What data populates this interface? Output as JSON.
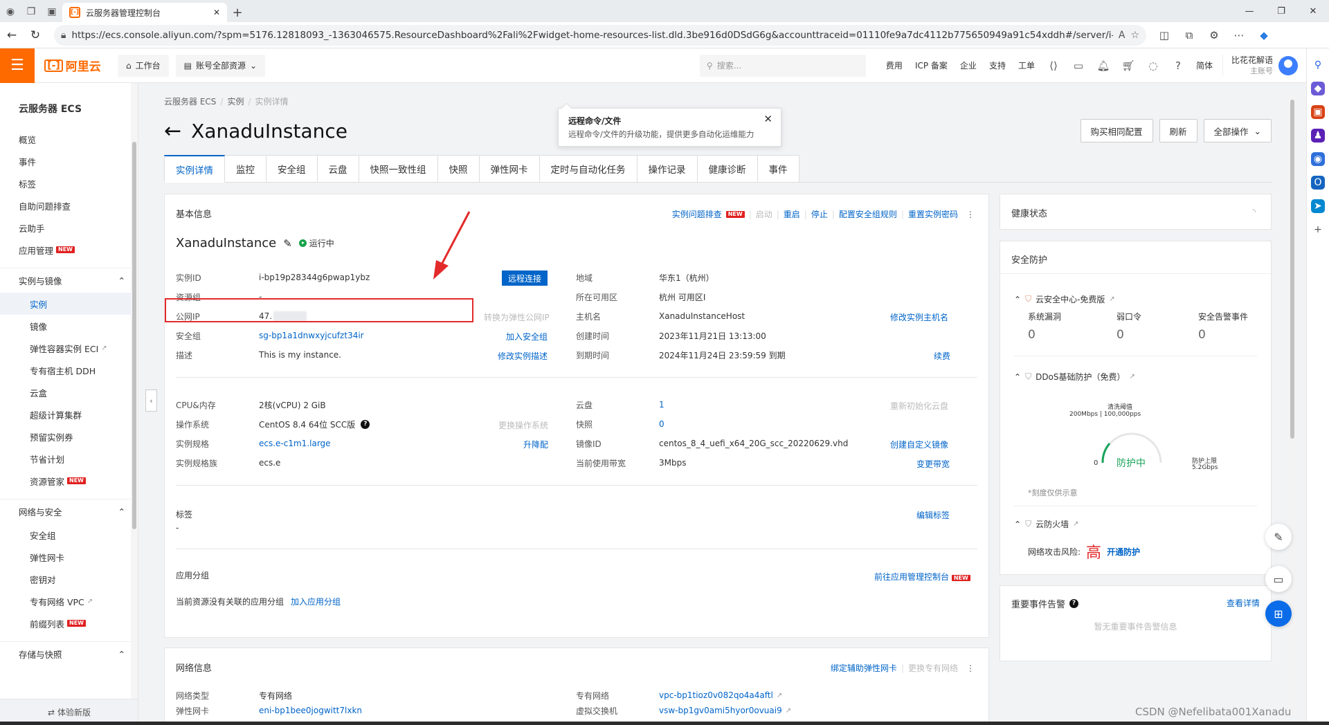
{
  "browser": {
    "tab_title": "云服务器管理控制台",
    "tab_favicon": "[-]",
    "url": "https://ecs.console.aliyun.com/?spm=5176.12818093_-1363046575.ResourceDashboard%2Fali%2Fwidget-home-resources-list.dld.3be916d0DSdG6g&accounttraceid=01110fe9a7dc4112b775650949a91c54xddh#/server/i-bp19p28344g6..."
  },
  "topnav": {
    "logo": "阿里云",
    "workbench": "工作台",
    "account_resources": "账号全部资源",
    "search_placeholder": "搜索...",
    "links": [
      "费用",
      "ICP 备案",
      "企业",
      "支持",
      "工单"
    ],
    "lang": "简体",
    "user_name": "比花花解语",
    "user_role": "主账号"
  },
  "sidebar": {
    "title": "云服务器 ECS",
    "top_items": [
      "概览",
      "事件",
      "标签",
      "自助问题排查",
      "云助手"
    ],
    "app_mgmt": "应用管理",
    "group1": "实例与镜像",
    "group1_items": [
      "实例",
      "镜像",
      "弹性容器实例 ECI",
      "专有宿主机 DDH",
      "云盒",
      "超级计算集群",
      "预留实例券",
      "节省计划",
      "资源管家"
    ],
    "group2": "网络与安全",
    "group2_items": [
      "安全组",
      "弹性网卡",
      "密钥对",
      "专有网络 VPC",
      "前缀列表"
    ],
    "group3": "存储与快照",
    "footer": "体验新版",
    "new_badge": "NEW"
  },
  "page": {
    "breadcrumb": [
      "云服务器 ECS",
      "实例",
      "实例详情"
    ],
    "title": "XanaduInstance",
    "tooltip_title": "远程命令/文件",
    "tooltip_text": "远程命令/文件的升级功能，提供更多自动化运维能力",
    "btn_buy": "购买相同配置",
    "btn_refresh": "刷新",
    "btn_all": "全部操作",
    "tabs": [
      "实例详情",
      "监控",
      "安全组",
      "云盘",
      "快照一致性组",
      "快照",
      "弹性网卡",
      "定时与自动化任务",
      "操作记录",
      "健康诊断",
      "事件"
    ]
  },
  "basic": {
    "header": "基本信息",
    "actions": {
      "troubleshoot": "实例问题排查",
      "start": "启动",
      "restart": "重启",
      "stop": "停止",
      "config_sg": "配置安全组规则",
      "reset_pwd": "重置实例密码"
    },
    "instance_name": "XanaduInstance",
    "status": "运行中",
    "remote_connect": "远程连接",
    "left": [
      {
        "label": "实例ID",
        "value": "i-bp19p28344g6pwap1ybz"
      },
      {
        "label": "资源组",
        "value": "-"
      },
      {
        "label": "公网IP",
        "value": "47."
      },
      {
        "label": "安全组",
        "value": "sg-bp1a1dnwxyjcufzt34ir"
      },
      {
        "label": "描述",
        "value": "This is my instance."
      }
    ],
    "left_links": {
      "eip": "转换为弹性公网IP",
      "add_sg": "加入安全组",
      "edit_desc": "修改实例描述"
    },
    "right": [
      {
        "label": "地域",
        "value": "华东1（杭州）"
      },
      {
        "label": "所在可用区",
        "value": "杭州 可用区I"
      },
      {
        "label": "主机名",
        "value": "XanaduInstanceHost"
      },
      {
        "label": "创建时间",
        "value": "2023年11月21日 13:13:00"
      },
      {
        "label": "到期时间",
        "value": "2024年11月24日 23:59:59 到期"
      }
    ],
    "right_links": {
      "hostname": "修改实例主机名",
      "renew": "续费"
    },
    "spec_left": [
      {
        "label": "CPU&内存",
        "value": "2核(vCPU) 2 GiB"
      },
      {
        "label": "操作系统",
        "value": "CentOS 8.4 64位 SCC版"
      },
      {
        "label": "实例规格",
        "value": "ecs.e-c1m1.large"
      },
      {
        "label": "实例规格族",
        "value": "ecs.e"
      }
    ],
    "spec_left_links": {
      "change_os": "更换操作系统",
      "upgrade": "升降配"
    },
    "spec_right": [
      {
        "label": "云盘",
        "value": "1"
      },
      {
        "label": "快照",
        "value": "0"
      },
      {
        "label": "镜像ID",
        "value": "centos_8_4_uefi_x64_20G_scc_20220629.vhd"
      },
      {
        "label": "当前使用带宽",
        "value": "3Mbps"
      }
    ],
    "spec_right_links": {
      "reinit": "重新初始化云盘",
      "create_image": "创建自定义镜像",
      "change_bw": "变更带宽"
    },
    "tags_label": "标签",
    "tags_value": "-",
    "edit_tags": "编辑标签",
    "app_group_label": "应用分组",
    "app_group_empty": "当前资源没有关联的应用分组",
    "add_app_group": "加入应用分组",
    "goto_app": "前往应用管理控制台"
  },
  "network": {
    "header": "网络信息",
    "bind_eni": "绑定辅助弹性网卡",
    "change_vpc": "更换专有网络",
    "type_label": "网络类型",
    "type_value": "专有网络",
    "eni_label": "弹性网卡",
    "eni_value": "eni-bp1bee0jogwitt7lxkn",
    "vpc_label": "专有网络",
    "vpc_value": "vpc-bp1tioz0v082qo4a4aftl",
    "vsw_label": "虚拟交换机",
    "vsw_value": "vsw-bp1gv0ami5hyor0ovuai9"
  },
  "right_panel": {
    "health": "健康状态",
    "security": "安全防护",
    "sec_center": "云安全中心-免费版",
    "stats": [
      {
        "label": "系统漏洞",
        "value": "0"
      },
      {
        "label": "弱口令",
        "value": "0"
      },
      {
        "label": "安全告警事件",
        "value": "0"
      }
    ],
    "ddos": "DDoS基础防护（免费）",
    "ddos_threshold_label": "清洗阈值",
    "ddos_threshold": "200Mbps | 100,000pps",
    "ddos_status": "防护中",
    "ddos_zero": "0",
    "ddos_limit_label": "防护上限",
    "ddos_limit": "5.2Gbps",
    "ddos_note": "*刻度仅供示意",
    "firewall": "云防火墙",
    "risk_label": "网络攻击风险:",
    "risk_level": "高",
    "enable_protect": "开通防护",
    "events": "重要事件告警",
    "view_detail": "查看详情",
    "no_events": "暂无重要事件告警信息"
  },
  "watermark": "CSDN @Nefelibata001Xanadu",
  "colors": {
    "accent": "#0064c8",
    "brand": "#ff6a00",
    "alert": "#e32a2a",
    "running": "#16a34a"
  }
}
